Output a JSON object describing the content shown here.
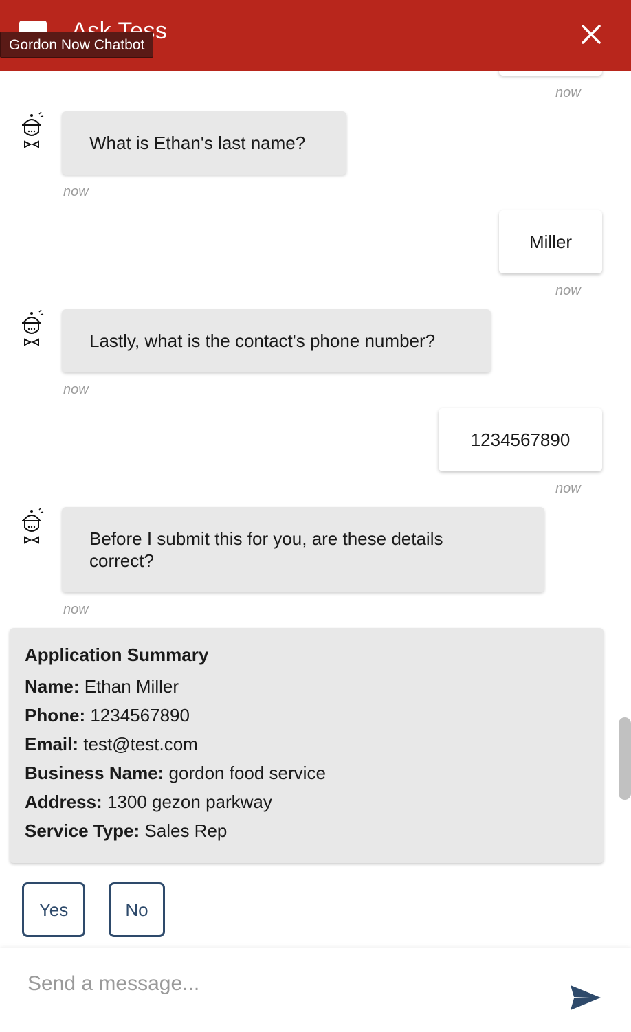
{
  "header": {
    "title": "Ask Tess",
    "tooltip": "Gordon Now Chatbot"
  },
  "messages": {
    "top_time": "now",
    "q_last_name": "What is Ethan's last name?",
    "q_last_name_time": "now",
    "a_last_name": "Miller",
    "a_last_name_time": "now",
    "q_phone": "Lastly, what is the contact's phone number?",
    "q_phone_time": "now",
    "a_phone": "1234567890",
    "a_phone_time": "now",
    "q_confirm": "Before I submit this for you, are these details correct?",
    "q_confirm_time": "now"
  },
  "summary": {
    "title": "Application Summary",
    "rows": [
      {
        "label": "Name:",
        "value": "Ethan Miller"
      },
      {
        "label": "Phone:",
        "value": "1234567890"
      },
      {
        "label": "Email:",
        "value": "test@test.com"
      },
      {
        "label": "Business Name:",
        "value": "gordon food service"
      },
      {
        "label": "Address:",
        "value": "1300 gezon parkway"
      },
      {
        "label": "Service Type:",
        "value": "Sales Rep"
      }
    ]
  },
  "choices": {
    "yes": "Yes",
    "no": "No"
  },
  "composer": {
    "placeholder": "Send a message..."
  },
  "icons": {
    "close": "close-icon",
    "send": "send-icon",
    "avatar": "chef-bot-avatar-icon"
  },
  "colors": {
    "header_bg": "#b8261c",
    "tooltip_bg": "#5a1a16",
    "bot_bubble": "#e8e8e8",
    "accent": "#2e4a6b"
  }
}
